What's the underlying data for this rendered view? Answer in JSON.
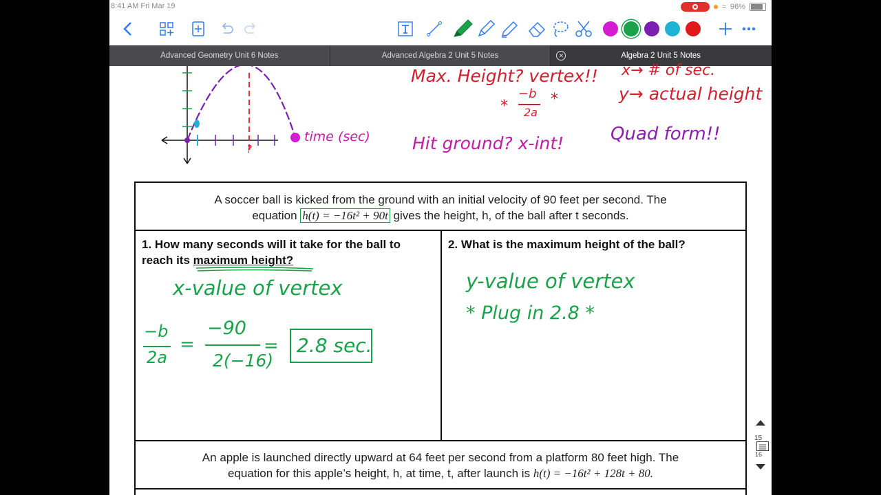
{
  "status_bar": {
    "time": "8:41 AM   Fri Mar 19",
    "battery": "96%"
  },
  "toolbar": {
    "icons": [
      "back-icon",
      "thumbnails-icon",
      "add-page-icon",
      "undo-icon",
      "redo-icon",
      "text-tool-icon",
      "line-tool-icon",
      "pen-icon",
      "pencil-icon",
      "highlighter-icon",
      "eraser-icon",
      "lasso-icon",
      "scissors-icon",
      "add-icon",
      "more-icon"
    ],
    "swatches": [
      "#d41cd3",
      "#1aa24a",
      "#7a1fb2",
      "#1eb3d6",
      "#e0191a"
    ]
  },
  "tabs": [
    {
      "label": "Advanced Geometry Unit 6 Notes"
    },
    {
      "label": "Advanced Algebra 2 Unit 5 Notes"
    },
    {
      "label": "Algebra 2 Unit 5 Notes"
    }
  ],
  "notes": {
    "max_height": "Max. Height? vertex!!",
    "x_note": "x→ # of sec.",
    "formula_num": "−b",
    "formula_den": "2a",
    "star": "*",
    "y_note": "y→ actual height",
    "hit_ground": "Hit ground? x-int!",
    "quad_form": "Quad form!!",
    "graph_label": "time (sec)",
    "graph_q": "?"
  },
  "problem1": {
    "line1": "A soccer ball is kicked from the ground with an initial velocity of 90 feet per second. The",
    "line2_pre": "equation",
    "equation": "h(t) = −16t² + 90t",
    "line2_post": "gives the height, h, of the ball after t seconds."
  },
  "q1": {
    "text_a": "1. How many seconds will it take for the ball to",
    "text_b_pre": "reach its",
    "text_b_u": "maximum height?",
    "hw_line1": "x-value of vertex",
    "hw_num1": "−b",
    "hw_den1": "2a",
    "hw_eq": "=",
    "hw_num2": "−90",
    "hw_den2": "2(−16)",
    "hw_eq2": "=",
    "hw_answer": "2.8 sec."
  },
  "q2": {
    "text": "2. What is the maximum height of the ball?",
    "hw_line1": "y-value of vertex",
    "hw_line2": "* Plug in 2.8 *"
  },
  "problem2": {
    "line1": "An apple is launched directly upward at 64 feet per second from a platform 80 feet high. The",
    "line2_pre": "equation for this apple’s height, h, at time, t, after launch is",
    "equation": "h(t) = −16t² + 128t + 80."
  },
  "scroller": {
    "page_current": "15",
    "page_total": "16"
  }
}
